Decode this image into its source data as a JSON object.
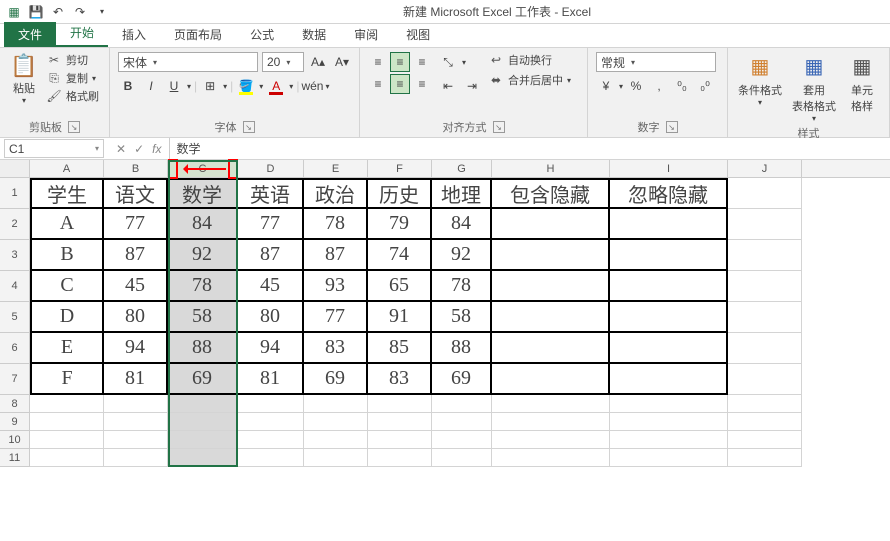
{
  "titlebar": {
    "text": "新建 Microsoft Excel 工作表 - Excel"
  },
  "tabs": {
    "file": "文件",
    "items": [
      "开始",
      "插入",
      "页面布局",
      "公式",
      "数据",
      "审阅",
      "视图"
    ],
    "active_index": 0
  },
  "ribbon": {
    "clipboard": {
      "paste": "粘贴",
      "cut": "剪切",
      "copy": "复制",
      "format_painter": "格式刷",
      "label": "剪贴板"
    },
    "font": {
      "name": "宋体",
      "size": "20",
      "bold": "B",
      "italic": "I",
      "underline": "U",
      "label": "字体"
    },
    "alignment": {
      "wrap": "自动换行",
      "merge": "合并后居中",
      "label": "对齐方式"
    },
    "number": {
      "format": "常规",
      "percent": "%",
      "comma": ",",
      "inc_dec": "⁰₀",
      "dec_dec": "₀⁰",
      "label": "数字"
    },
    "styles": {
      "cond_format": "条件格式",
      "table_format": "套用\n表格格式",
      "cell_styles": "单元\n格样",
      "label": "样式"
    }
  },
  "namebox": "C1",
  "formula_value": "数学",
  "columns": {
    "letters": [
      "A",
      "B",
      "C",
      "D",
      "E",
      "F",
      "G",
      "H",
      "I",
      "J"
    ],
    "widths": [
      74,
      64,
      70,
      66,
      64,
      64,
      60,
      118,
      118,
      74
    ],
    "selected_index": 2
  },
  "rows": {
    "headers": [
      "学生",
      "语文",
      "数学",
      "英语",
      "政治",
      "历史",
      "地理",
      "包含隐藏",
      "忽略隐藏"
    ],
    "data": [
      [
        "A",
        "77",
        "84",
        "77",
        "78",
        "79",
        "84",
        "",
        ""
      ],
      [
        "B",
        "87",
        "92",
        "87",
        "87",
        "74",
        "92",
        "",
        ""
      ],
      [
        "C",
        "45",
        "78",
        "45",
        "93",
        "65",
        "78",
        "",
        ""
      ],
      [
        "D",
        "80",
        "58",
        "80",
        "77",
        "91",
        "58",
        "",
        ""
      ],
      [
        "E",
        "94",
        "88",
        "94",
        "83",
        "85",
        "88",
        "",
        ""
      ],
      [
        "F",
        "81",
        "69",
        "81",
        "69",
        "83",
        "69",
        "",
        ""
      ]
    ],
    "row_numbers": [
      1,
      2,
      3,
      4,
      5,
      6,
      7,
      8,
      9,
      10,
      11
    ]
  },
  "chart_data": {
    "type": "table",
    "title": "",
    "columns": [
      "学生",
      "语文",
      "数学",
      "英语",
      "政治",
      "历史",
      "地理",
      "包含隐藏",
      "忽略隐藏"
    ],
    "rows": [
      {
        "学生": "A",
        "语文": 77,
        "数学": 84,
        "英语": 77,
        "政治": 78,
        "历史": 79,
        "地理": 84,
        "包含隐藏": null,
        "忽略隐藏": null
      },
      {
        "学生": "B",
        "语文": 87,
        "数学": 92,
        "英语": 87,
        "政治": 87,
        "历史": 74,
        "地理": 92,
        "包含隐藏": null,
        "忽略隐藏": null
      },
      {
        "学生": "C",
        "语文": 45,
        "数学": 78,
        "英语": 45,
        "政治": 93,
        "历史": 65,
        "地理": 78,
        "包含隐藏": null,
        "忽略隐藏": null
      },
      {
        "学生": "D",
        "语文": 80,
        "数学": 58,
        "英语": 80,
        "政治": 77,
        "历史": 91,
        "地理": 58,
        "包含隐藏": null,
        "忽略隐藏": null
      },
      {
        "学生": "E",
        "语文": 94,
        "数学": 88,
        "英语": 94,
        "政治": 83,
        "历史": 85,
        "地理": 88,
        "包含隐藏": null,
        "忽略隐藏": null
      },
      {
        "学生": "F",
        "语文": 81,
        "数学": 69,
        "英语": 81,
        "政治": 69,
        "历史": 83,
        "地理": 69,
        "包含隐藏": null,
        "忽略隐藏": null
      }
    ]
  }
}
